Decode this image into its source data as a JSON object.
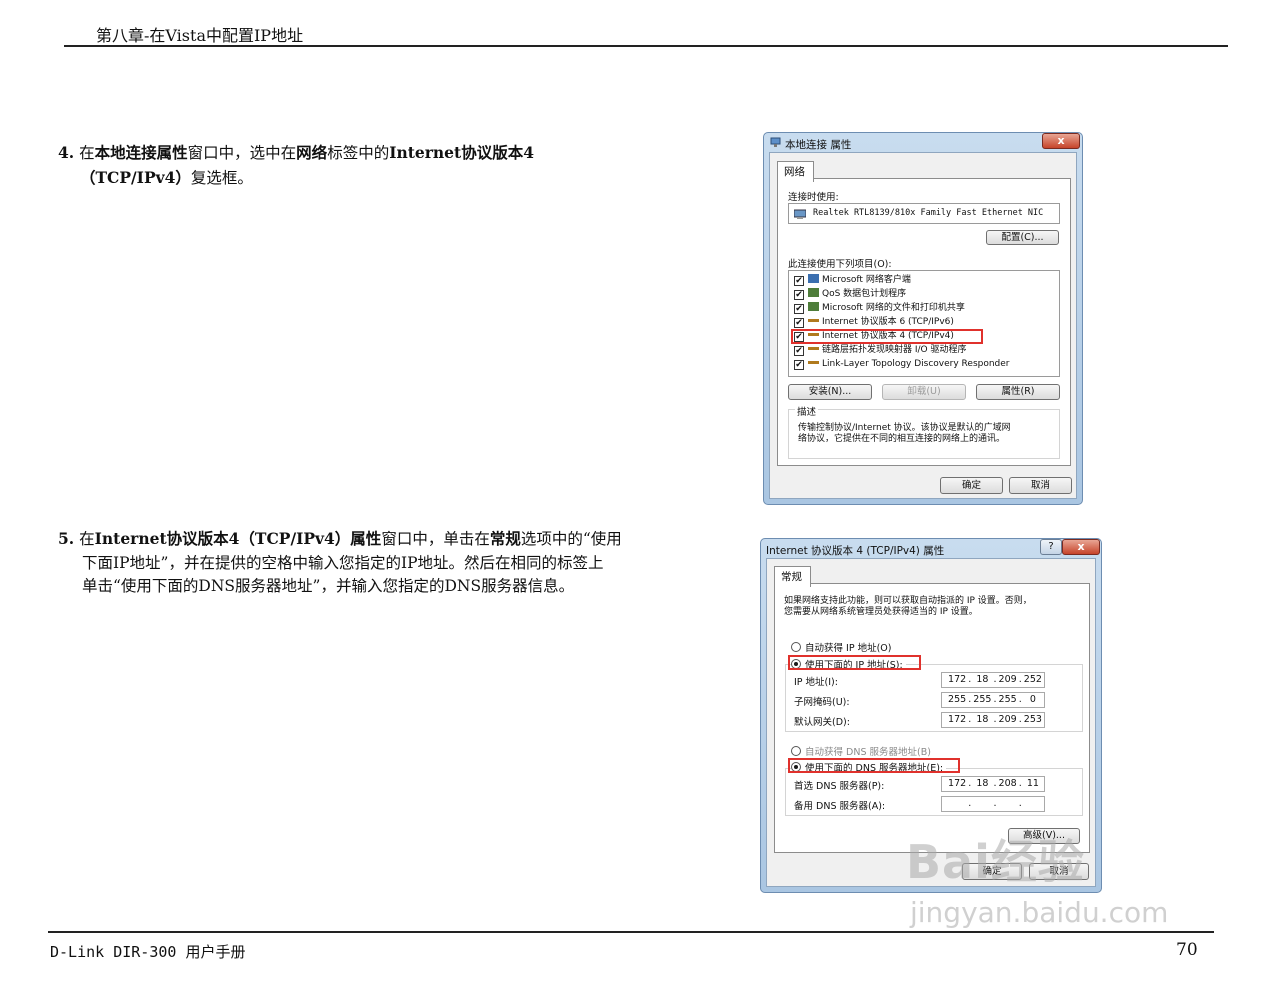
{
  "header": {
    "title": "第八章-在Vista中配置IP地址"
  },
  "footer": {
    "left": "D-Link DIR-300 用户手册",
    "page_number": "70"
  },
  "step4": {
    "number": "4.",
    "t1": "在",
    "b1": "本地连接属性",
    "t2": "窗口中，选中在",
    "b2": "网络",
    "t3": "标签中的",
    "b3": "Internet协议版本4",
    "b4": "（TCP/IPv4）",
    "t4": "复选框。"
  },
  "step5": {
    "number": "5.",
    "t1": "在",
    "b1": "Internet协议版本4（TCP/IPv4）属性",
    "t2": "窗口中，单击在",
    "b2": "常规",
    "t3": "选项中的“使用",
    "line2": "下面IP地址”，并在提供的空格中输入您指定的IP地址。然后在相同的标签上",
    "line3": "单击“使用下面的DNS服务器地址”，并输入您指定的DNS服务器信息。"
  },
  "dialog1": {
    "title": "本地连接 属性",
    "close": "x",
    "tab": "网络",
    "connect_using_label": "连接时使用:",
    "adapter": "Realtek RTL8139/810x Family Fast Ethernet NIC",
    "configure_button": "配置(C)...",
    "items_label": "此连接使用下列项目(O):",
    "items": [
      {
        "label": "Microsoft 网络客户端",
        "checked": "✔"
      },
      {
        "label": "QoS 数据包计划程序",
        "checked": "✔"
      },
      {
        "label": "Microsoft 网络的文件和打印机共享",
        "checked": "✔"
      },
      {
        "label": "Internet 协议版本 6 (TCP/IPv6)",
        "checked": "✔"
      },
      {
        "label": "Internet 协议版本 4 (TCP/IPv4)",
        "checked": "✔"
      },
      {
        "label": "链路层拓扑发现映射器 I/O 驱动程序",
        "checked": "✔"
      },
      {
        "label": "Link-Layer Topology Discovery Responder",
        "checked": "✔"
      }
    ],
    "install_button": "安装(N)...",
    "uninstall_button": "卸载(U)",
    "properties_button": "属性(R)",
    "description_label": "描述",
    "description_line1": "传输控制协议/Internet 协议。该协议是默认的广域网",
    "description_line2": "络协议，它提供在不同的相互连接的网络上的通讯。",
    "ok_button": "确定",
    "cancel_button": "取消"
  },
  "dialog2": {
    "title": "Internet 协议版本 4 (TCP/IPv4) 属性",
    "help": "?",
    "close": "x",
    "tab": "常规",
    "intro_line1": "如果网络支持此功能，则可以获取自动指派的 IP 设置。否则，",
    "intro_line2": "您需要从网络系统管理员处获得适当的 IP 设置。",
    "auto_ip": "自动获得 IP 地址(O)",
    "manual_ip": "使用下面的 IP 地址(S):",
    "ip_label": "IP 地址(I):",
    "mask_label": "子网掩码(U):",
    "gateway_label": "默认网关(D):",
    "ip": [
      "172",
      "18",
      "209",
      "252"
    ],
    "mask": [
      "255",
      "255",
      "255",
      "0"
    ],
    "gateway": [
      "172",
      "18",
      "209",
      "253"
    ],
    "auto_dns": "自动获得 DNS 服务器地址(B)",
    "manual_dns": "使用下面的 DNS 服务器地址(E):",
    "pref_dns_label": "首选 DNS 服务器(P):",
    "alt_dns_label": "备用 DNS 服务器(A):",
    "pref_dns": [
      "172",
      "18",
      "208",
      "11"
    ],
    "alt_dns": [
      "",
      "",
      "",
      ""
    ],
    "dot": ".",
    "advanced_button": "高级(V)...",
    "ok_button": "确定",
    "cancel_button": "取消"
  },
  "watermark": {
    "logo": "Bai经验",
    "url": "jingyan.baidu.com"
  }
}
